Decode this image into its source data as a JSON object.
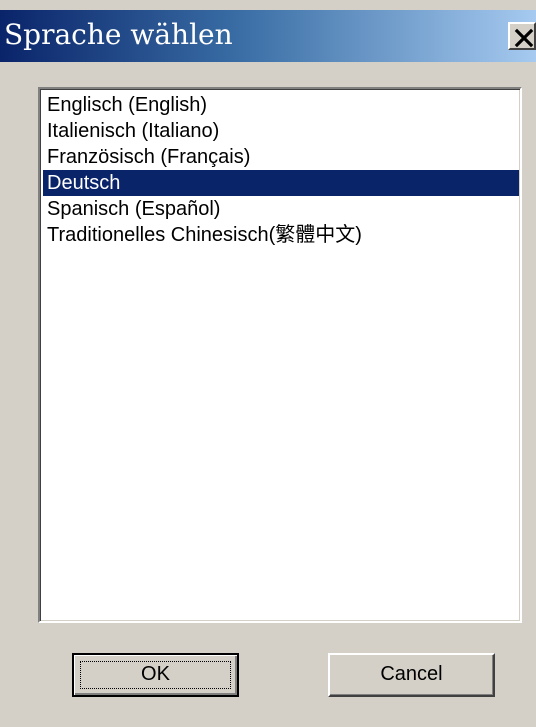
{
  "window": {
    "title": "Sprache wählen",
    "close_glyph": "✕",
    "close_icon": "close-icon"
  },
  "language_list": {
    "items": [
      {
        "label": "Englisch (English)"
      },
      {
        "label": "Italienisch (Italiano)"
      },
      {
        "label": "Französisch (Français)"
      },
      {
        "label": "Deutsch"
      },
      {
        "label": "Spanisch (Español)"
      },
      {
        "label": "Traditionelles Chinesisch(繁體中文)"
      }
    ],
    "selected_index": 3
  },
  "buttons": {
    "ok_label": "OK",
    "cancel_label": "Cancel"
  },
  "colors": {
    "title_bar_start": "#0a246a",
    "title_bar_end": "#a6caf0",
    "selection": "#0a246a",
    "face": "#d4d0c8"
  }
}
